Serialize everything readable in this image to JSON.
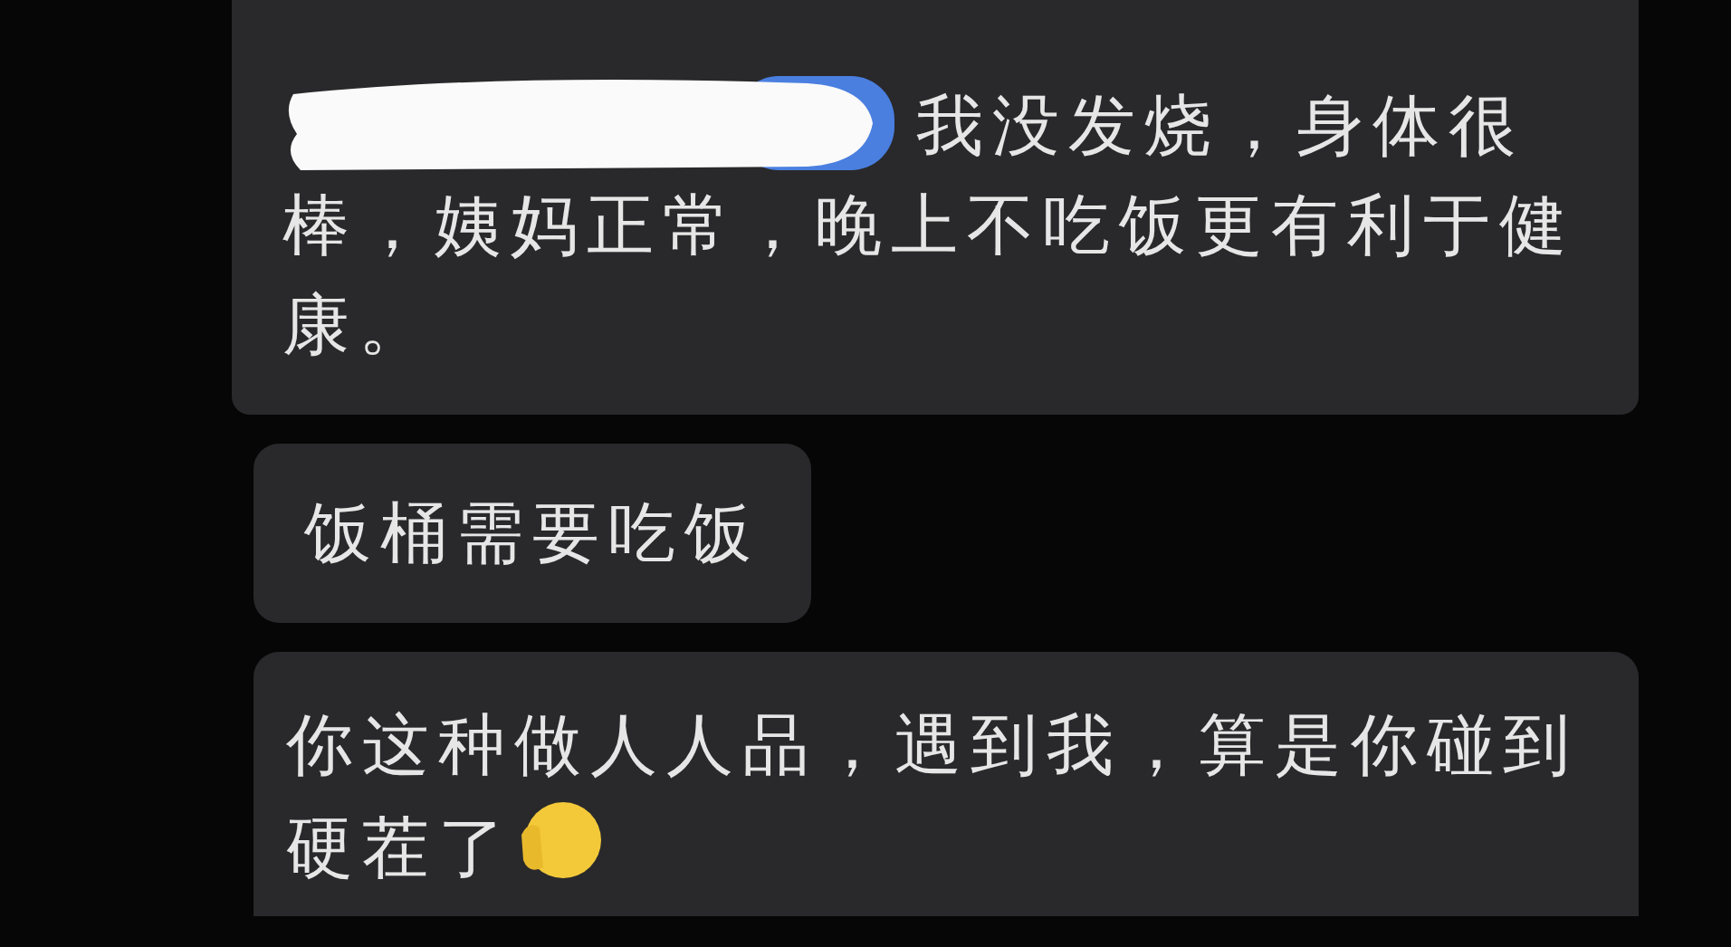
{
  "messages": [
    {
      "text": "我没发烧，身体很棒，姨妈正常，晚上不吃饭更有利于健康。",
      "redacted_mention": true,
      "emoji": false,
      "wide": true
    },
    {
      "text": "饭桶需要吃饭",
      "redacted_mention": false,
      "emoji": false,
      "wide": false
    },
    {
      "text": "你这种做人人品，遇到我，算是你碰到硬茬了",
      "redacted_mention": false,
      "emoji": true,
      "wide": true
    }
  ]
}
